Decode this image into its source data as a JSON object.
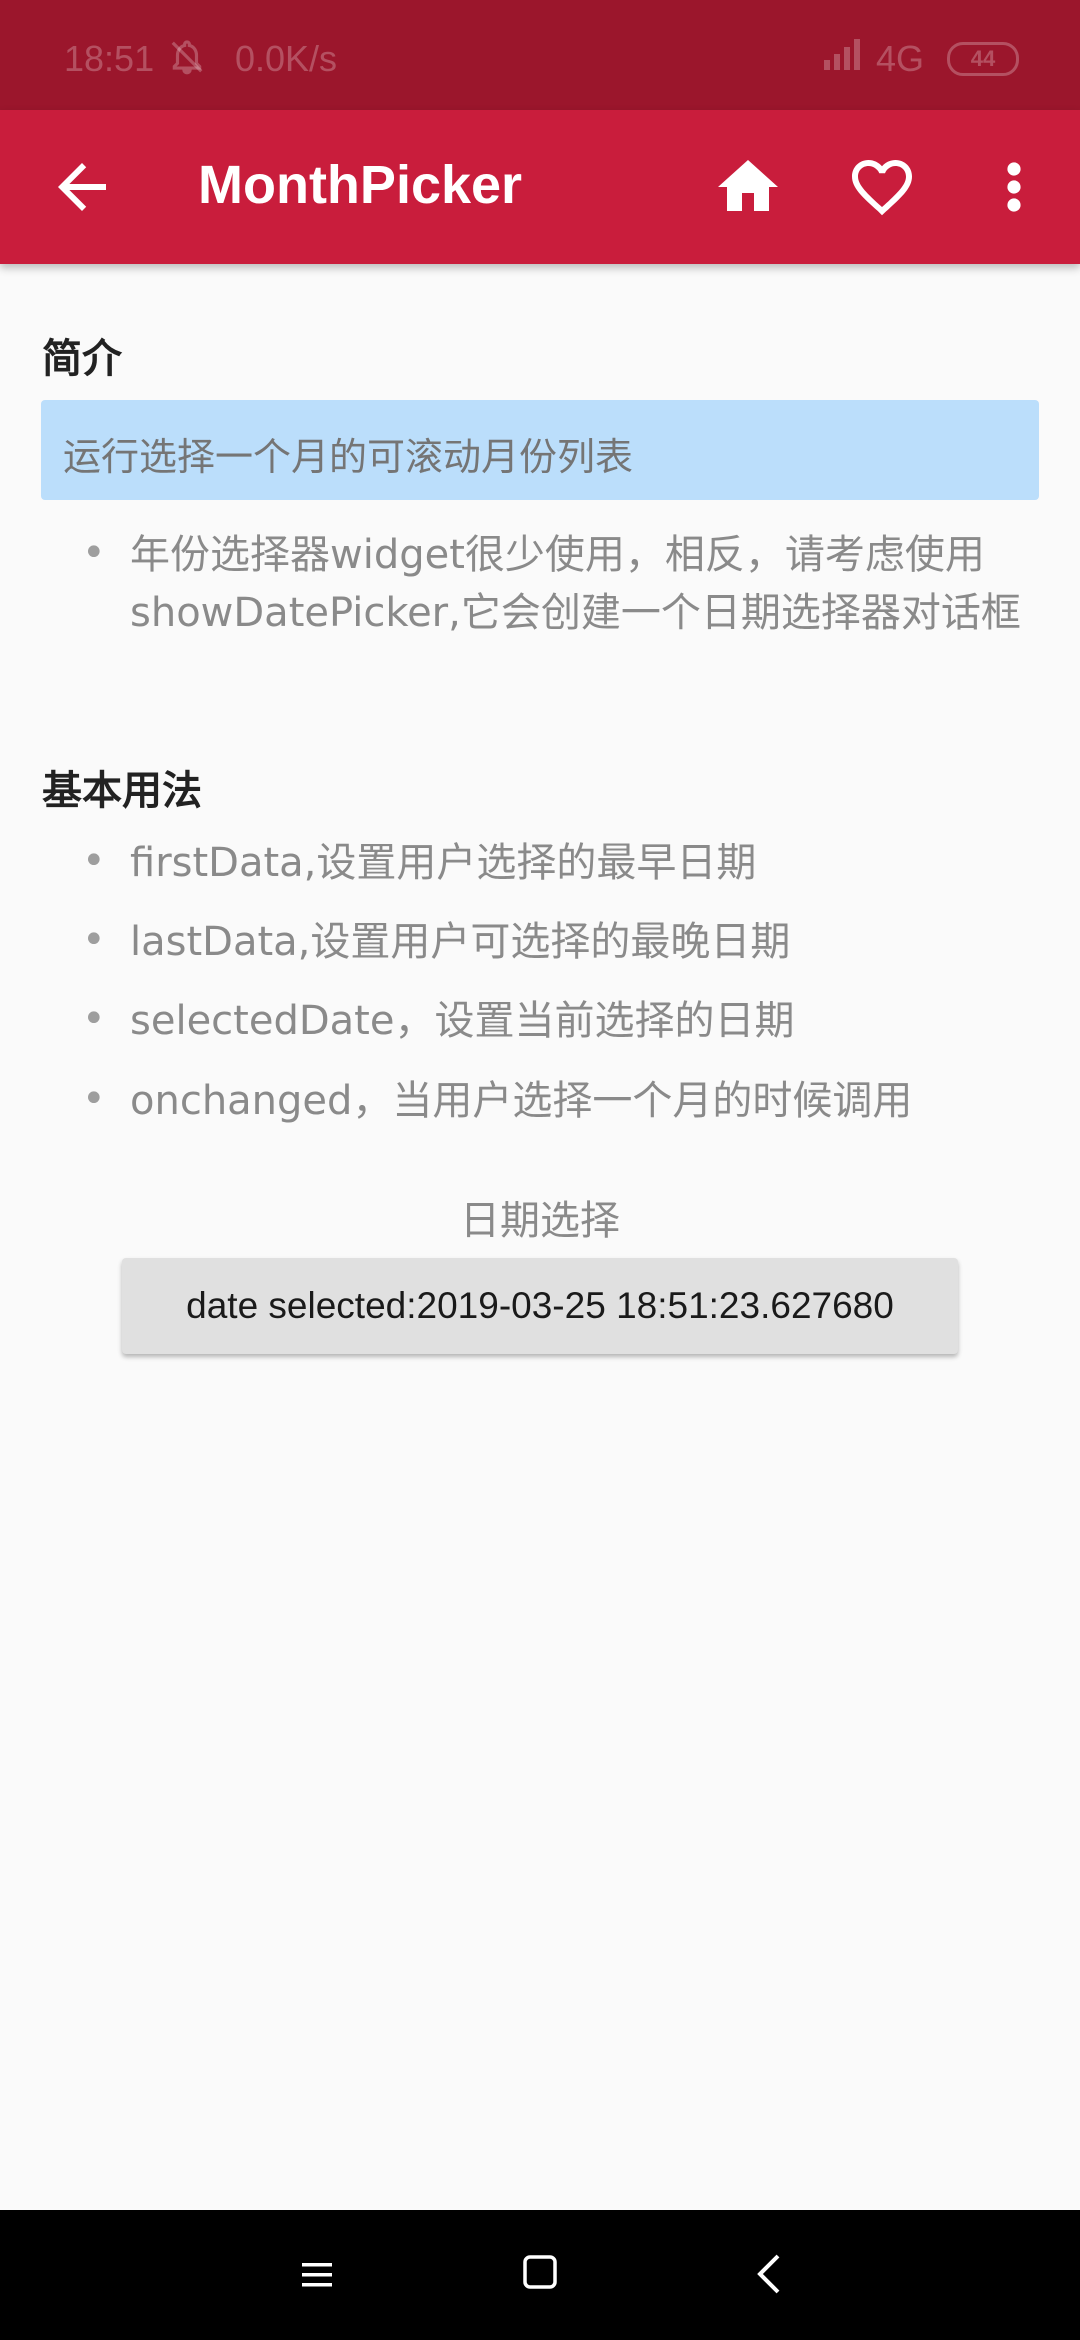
{
  "status_bar": {
    "time": "18:51",
    "speed": "0.0K/s",
    "network": "4G",
    "battery": "44"
  },
  "app_bar": {
    "title": "MonthPicker",
    "icons": [
      "back-arrow-icon",
      "home-icon",
      "heart-icon",
      "more-vert-icon"
    ]
  },
  "intro": {
    "heading": "简介",
    "highlight": "运行选择一个月的可滚动月份列表",
    "bullet": "年份选择器widget很少使用，相反，请考虑使用showDatePicker,它会创建一个日期选择器对话框"
  },
  "usage": {
    "heading": "基本用法",
    "items": [
      "firstData,设置用户选择的最早日期",
      "lastData,设置用户可选择的最晚日期",
      "selectedDate，设置当前选择的日期",
      "onchanged，当用户选择一个月的时候调用"
    ]
  },
  "picker": {
    "label": "日期选择",
    "button_text": "date selected:2019-03-25 18:51:23.627680"
  },
  "colors": {
    "app_bar": "#c91d3c",
    "status_bar": "#9b162c",
    "highlight_bg": "#bbdefb",
    "button_bg": "#e0e0e0"
  }
}
